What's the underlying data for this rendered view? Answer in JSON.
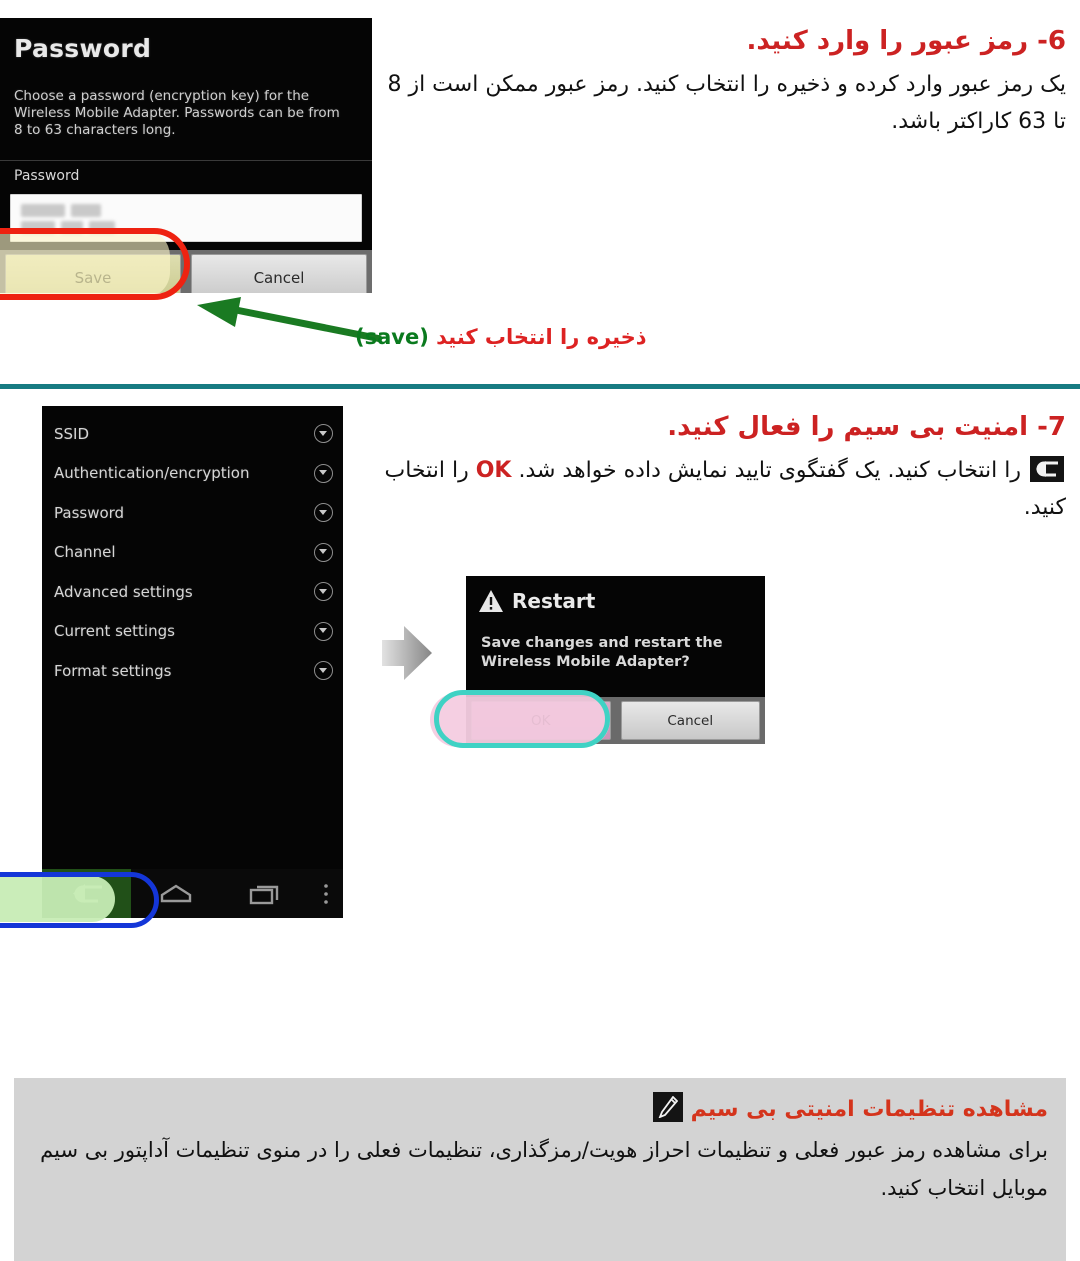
{
  "step6": {
    "heading": "6- رمز عبور را وارد کنید.",
    "body": "یک رمز عبور وارد کرده و ذخیره را انتخاب کنید. رمز عبور ممکن است از 8 تا 63 کاراکتر باشد.",
    "caption_fa": "ذخیره را انتخاب کنید",
    "caption_en": "(save)"
  },
  "password_screen": {
    "title": "Password",
    "description": "Choose a password (encryption key) for the Wireless Mobile Adapter.\nPasswords can be from 8 to 63 characters long.",
    "field_label": "Password",
    "field_value": "••••••••",
    "save_label": "Save",
    "cancel_label": "Cancel"
  },
  "step7": {
    "heading": "7- امنیت بی سیم را فعال کنید.",
    "body_part1": " را انتخاب کنید. یک گفتگوی تایید نمایش داده خواهد شد. ",
    "body_ok": "OK",
    "body_part2": " را انتخاب کنید.",
    "back_icon": "back-arrow-icon"
  },
  "settings_menu": {
    "items": [
      {
        "label": "SSID"
      },
      {
        "label": "Authentication/encryption"
      },
      {
        "label": "Password"
      },
      {
        "label": "Channel"
      },
      {
        "label": "Advanced settings"
      },
      {
        "label": "Current settings"
      },
      {
        "label": "Format settings"
      }
    ],
    "nav": {
      "back": "back-icon",
      "home": "home-icon",
      "recents": "recents-icon",
      "overflow": "overflow-menu-icon"
    }
  },
  "restart_dialog": {
    "title": "Restart",
    "message": "Save changes and restart the Wireless Mobile Adapter?",
    "ok_label": "OK",
    "cancel_label": "Cancel",
    "warn_icon": "warning-triangle-icon"
  },
  "note": {
    "heading": "مشاهده تنظیمات امنیتی بی سیم",
    "body": "برای مشاهده رمز عبور فعلی و تنظیمات احراز هویت/رمزگذاری، تنظیمات فعلی را در منوی تنظیمات آداپتور بی سیم موبایل انتخاب کنید.",
    "icon": "pencil-note-icon"
  },
  "colors": {
    "heading_red": "#cc2222",
    "note_red": "#d4341c",
    "teal_rule": "#177b82",
    "highlight_red": "#ee2211",
    "highlight_blue": "#1436d8",
    "highlight_teal": "#3fd2c4",
    "arrow_green": "#1a7a22",
    "note_bg": "#d3d3d3"
  }
}
